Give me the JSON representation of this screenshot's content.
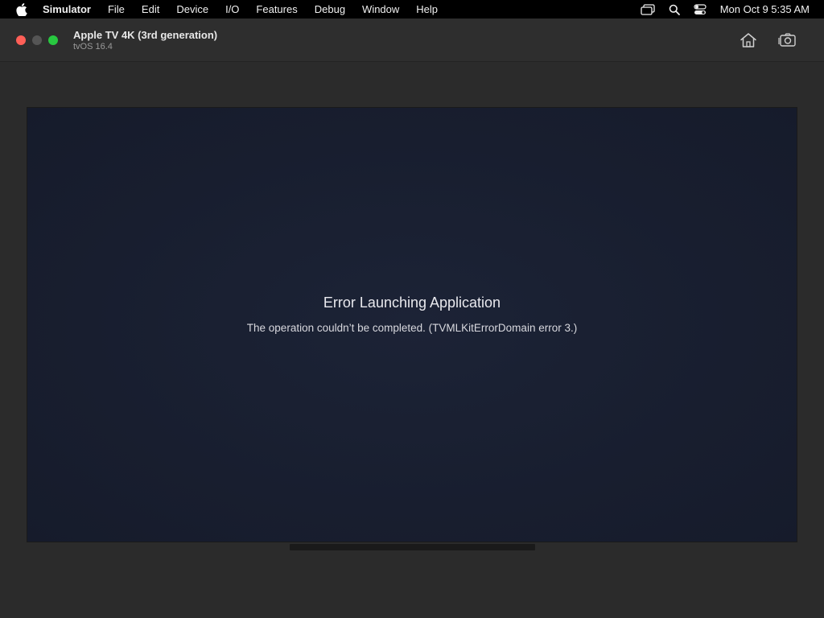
{
  "menubar": {
    "apple_icon": "apple-logo-icon",
    "app_name": "Simulator",
    "items": [
      "File",
      "Edit",
      "Device",
      "I/O",
      "Features",
      "Debug",
      "Window",
      "Help"
    ],
    "status_icons": [
      "screen-mirroring-icon",
      "search-icon",
      "control-center-icon"
    ],
    "clock": "Mon Oct 9  5:35 AM"
  },
  "window": {
    "title": "Apple TV 4K (3rd generation)",
    "subtitle": "tvOS 16.4",
    "buttons": {
      "home_icon": "home-icon",
      "screenshot_icon": "camera-icon"
    },
    "traffic_colors": {
      "close": "#ff5f57",
      "minimize": "#555555",
      "zoom": "#28c840"
    }
  },
  "screen": {
    "error_title": "Error Launching Application",
    "error_message": "The operation couldn’t be completed. (TVMLKitErrorDomain error 3.)",
    "background_color": "#1a2031"
  }
}
